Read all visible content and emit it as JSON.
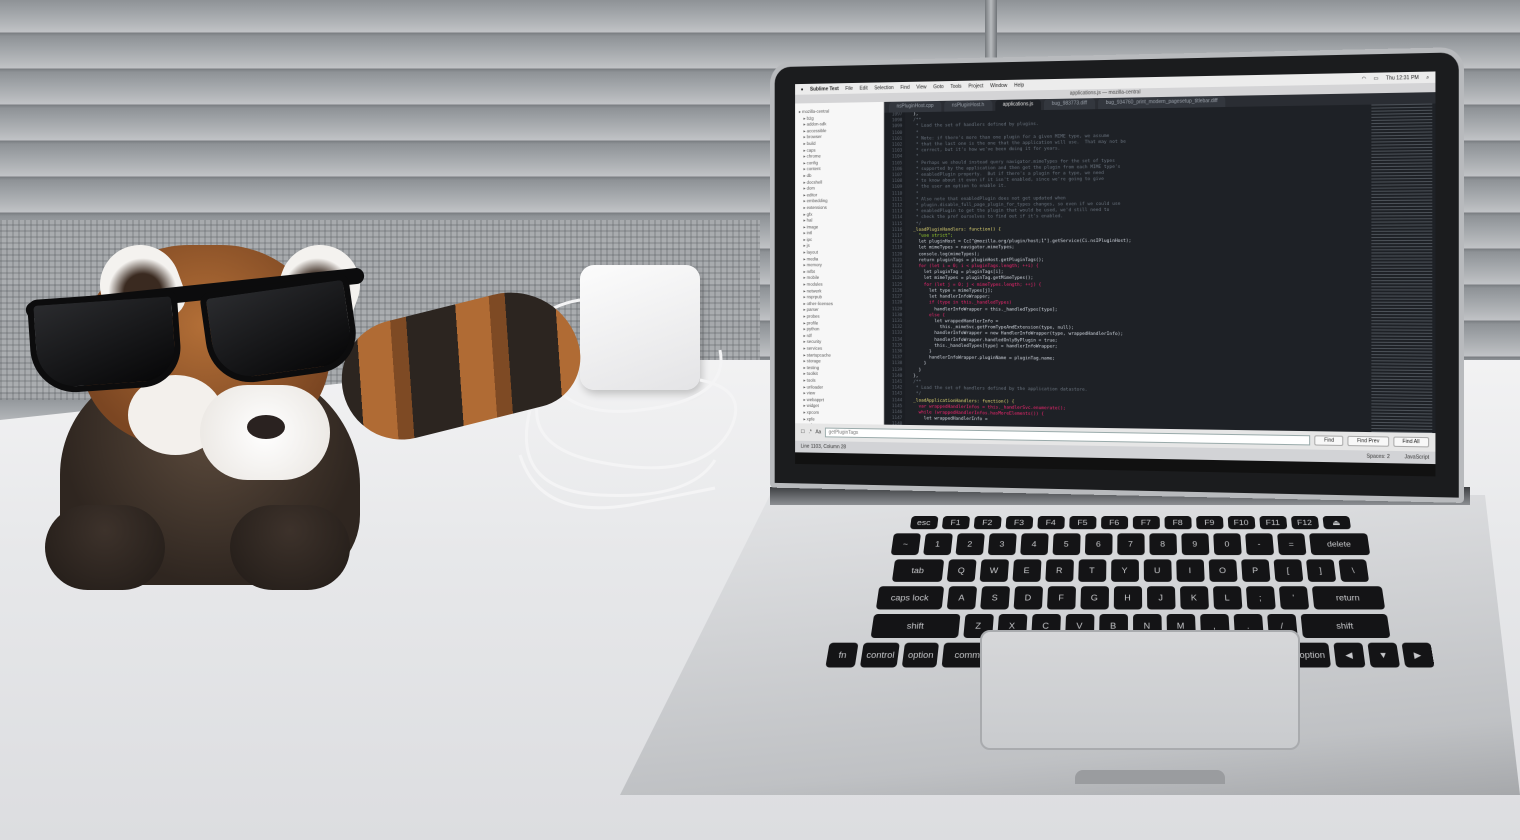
{
  "menubar": {
    "app": "Sublime Text",
    "items": [
      "File",
      "Edit",
      "Selection",
      "Find",
      "View",
      "Goto",
      "Tools",
      "Project",
      "Window",
      "Help"
    ],
    "clock": "Thu 12:31 PM"
  },
  "window": {
    "title": "applications.js — mozilla-central"
  },
  "tabs": [
    {
      "label": "nsPluginHost.cpp",
      "active": false
    },
    {
      "label": "nsPluginHost.h",
      "active": false
    },
    {
      "label": "applications.js",
      "active": true
    },
    {
      "label": "bug_983773.diff",
      "active": false
    },
    {
      "label": "bug_934760_print_modern_pagesetup_titlebar.diff",
      "active": false
    }
  ],
  "sidebar": {
    "folders": [
      "mozilla-central",
      "b2g",
      "addon-sdk",
      "accessible",
      "browser",
      "build",
      "caps",
      "chrome",
      "config",
      "content",
      "db",
      "docshell",
      "dom",
      "editor",
      "embedding",
      "extensions",
      "gfx",
      "hal",
      "image",
      "intl",
      "ipc",
      "js",
      "layout",
      "media",
      "memory",
      "mfbt",
      "mobile",
      "modules",
      "netwerk",
      "nsprpub",
      "other-licenses",
      "parser",
      "probes",
      "profile",
      "python",
      "rdf",
      "security",
      "services",
      "startupcache",
      "storage",
      "testing",
      "toolkit",
      "tools",
      "uriloader",
      "view",
      "webapprt",
      "widget",
      "xpcom",
      "xpfe",
      "xulrunner"
    ]
  },
  "editor": {
    "first_line": 1097,
    "lines": [
      {
        "t": "  },",
        "c": ""
      },
      {
        "t": "",
        "c": ""
      },
      {
        "t": "  /**",
        "c": "cmt"
      },
      {
        "t": "   * Load the set of handlers defined by plugins.",
        "c": "cmt"
      },
      {
        "t": "   *",
        "c": "cmt"
      },
      {
        "t": "   * Note: if there's more than one plugin for a given MIME type, we assume",
        "c": "cmt"
      },
      {
        "t": "   * that the last one is the one that the application will use.  That may not be",
        "c": "cmt"
      },
      {
        "t": "   * correct, but it's how we've been doing it for years.",
        "c": "cmt"
      },
      {
        "t": "   *",
        "c": "cmt"
      },
      {
        "t": "   * Perhaps we should instead query navigator.mimeTypes for the set of types",
        "c": "cmt"
      },
      {
        "t": "   * supported by the application and then get the plugin from each MIME type's",
        "c": "cmt"
      },
      {
        "t": "   * enabledPlugin property.  But if there's a plugin for a type, we need",
        "c": "cmt"
      },
      {
        "t": "   * to know about it even if it isn't enabled, since we're going to give",
        "c": "cmt"
      },
      {
        "t": "   * the user an option to enable it.",
        "c": "cmt"
      },
      {
        "t": "   *",
        "c": "cmt"
      },
      {
        "t": "   * Also note that enabledPlugin does not get updated when",
        "c": "cmt"
      },
      {
        "t": "   * plugin.disable_full_page_plugin_for_types changes, so even if we could use",
        "c": "cmt"
      },
      {
        "t": "   * enabledPlugin to get the plugin that would be used, we'd still need to",
        "c": "cmt"
      },
      {
        "t": "   * check the pref ourselves to find out if it's enabled.",
        "c": "cmt"
      },
      {
        "t": "   */",
        "c": "cmt"
      },
      {
        "t": "  _loadPluginHandlers: function() {",
        "c": "fn"
      },
      {
        "t": "    \"use strict\";",
        "c": "str"
      },
      {
        "t": "",
        "c": ""
      },
      {
        "t": "    let pluginHost = Cc[\"@mozilla.org/plugin/host;1\"].getService(Ci.nsIPluginHost);",
        "c": ""
      },
      {
        "t": "",
        "c": ""
      },
      {
        "t": "    let mimeTypes = navigator.mimeTypes;",
        "c": ""
      },
      {
        "t": "    console.log(mimeTypes);",
        "c": ""
      },
      {
        "t": "",
        "c": ""
      },
      {
        "t": "    return pluginTags = pluginHost.getPluginTags();",
        "c": ""
      },
      {
        "t": "",
        "c": ""
      },
      {
        "t": "    for (let i = 0; i < pluginTags.length; ++i) {",
        "c": "kw"
      },
      {
        "t": "      let pluginTag = pluginTags[i];",
        "c": ""
      },
      {
        "t": "",
        "c": ""
      },
      {
        "t": "      let mimeTypes = pluginTag.getMimeTypes();",
        "c": ""
      },
      {
        "t": "      for (let j = 0; j < mimeTypes.length; ++j) {",
        "c": "kw"
      },
      {
        "t": "        let type = mimeTypes[j];",
        "c": ""
      },
      {
        "t": "",
        "c": ""
      },
      {
        "t": "        let handlerInfoWrapper;",
        "c": ""
      },
      {
        "t": "        if (type in this._handledTypes)",
        "c": "kw"
      },
      {
        "t": "          handlerInfoWrapper = this._handledTypes[type];",
        "c": ""
      },
      {
        "t": "        else {",
        "c": "kw"
      },
      {
        "t": "          let wrappedHandlerInfo =",
        "c": ""
      },
      {
        "t": "            this._mimeSvc.getFromTypeAndExtension(type, null);",
        "c": ""
      },
      {
        "t": "          handlerInfoWrapper = new HandlerInfoWrapper(type, wrappedHandlerInfo);",
        "c": ""
      },
      {
        "t": "          handlerInfoWrapper.handledOnlyByPlugin = true;",
        "c": ""
      },
      {
        "t": "          this._handledTypes[type] = handlerInfoWrapper;",
        "c": ""
      },
      {
        "t": "        }",
        "c": ""
      },
      {
        "t": "",
        "c": ""
      },
      {
        "t": "        handlerInfoWrapper.pluginName = pluginTag.name;",
        "c": ""
      },
      {
        "t": "      }",
        "c": ""
      },
      {
        "t": "    }",
        "c": ""
      },
      {
        "t": "  },",
        "c": ""
      },
      {
        "t": "",
        "c": ""
      },
      {
        "t": "  /**",
        "c": "cmt"
      },
      {
        "t": "   * Load the set of handlers defined by the application datastore.",
        "c": "cmt"
      },
      {
        "t": "   */",
        "c": "cmt"
      },
      {
        "t": "  _loadApplicationHandlers: function() {",
        "c": "fn"
      },
      {
        "t": "    var wrappedHandlerInfos = this._handlerSvc.enumerate();",
        "c": "kw"
      },
      {
        "t": "    while (wrappedHandlerInfos.hasMoreElements()) {",
        "c": "kw"
      },
      {
        "t": "      let wrappedHandlerInfo =",
        "c": ""
      }
    ]
  },
  "findbar": {
    "placeholder": "getPluginTags",
    "buttons": [
      "Find",
      "Find Prev",
      "Find All"
    ]
  },
  "statusbar": {
    "position": "Line 1103, Column 28",
    "indent": "Spaces: 2",
    "syntax": "JavaScript"
  },
  "keyboard": {
    "rows": [
      [
        "esc",
        "F1",
        "F2",
        "F3",
        "F4",
        "F5",
        "F6",
        "F7",
        "F8",
        "F9",
        "F10",
        "F11",
        "F12",
        "⏏"
      ],
      [
        "~",
        "1",
        "2",
        "3",
        "4",
        "5",
        "6",
        "7",
        "8",
        "9",
        "0",
        "-",
        "=",
        "delete"
      ],
      [
        "tab",
        "Q",
        "W",
        "E",
        "R",
        "T",
        "Y",
        "U",
        "I",
        "O",
        "P",
        "[",
        "]",
        "\\"
      ],
      [
        "caps lock",
        "A",
        "S",
        "D",
        "F",
        "G",
        "H",
        "J",
        "K",
        "L",
        ";",
        "'",
        "return"
      ],
      [
        "shift",
        "Z",
        "X",
        "C",
        "V",
        "B",
        "N",
        "M",
        ",",
        ".",
        "/",
        "shift"
      ],
      [
        "fn",
        "control",
        "option",
        "command",
        "",
        "command",
        "option",
        "◀",
        "▼",
        "▶"
      ]
    ]
  }
}
